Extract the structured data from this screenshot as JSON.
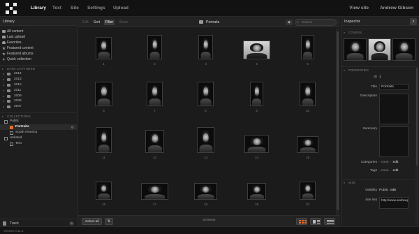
{
  "topbar": {
    "nav": [
      "Library",
      "Text",
      "Site",
      "Settings",
      "Upload"
    ],
    "active_nav": 0,
    "view_site": "View site",
    "user_name": "Andrew Gibson"
  },
  "sidebar": {
    "title": "Library",
    "items": [
      {
        "label": "All content",
        "icon": "stack-icon"
      },
      {
        "label": "Last upload",
        "icon": "upload-icon"
      },
      {
        "label": "Favorites",
        "icon": "heart-icon"
      },
      {
        "label": "Featured content",
        "icon": "star-icon"
      },
      {
        "label": "Featured albums",
        "icon": "star-album-icon"
      },
      {
        "label": "Quick collection",
        "icon": "lightning-icon"
      }
    ],
    "date_section": "DATE CAPTURED",
    "years": [
      "2014",
      "2013",
      "2012",
      "2011",
      "2009",
      "2008",
      "2007"
    ],
    "collections_section": "COLLECTIONS",
    "collections": [
      {
        "label": "Public",
        "level": 0,
        "selected": false
      },
      {
        "label": "Portraits",
        "level": 1,
        "selected": true
      },
      {
        "label": "South America",
        "level": 1,
        "selected": false
      },
      {
        "label": "Unlisted",
        "level": 0,
        "selected": false
      },
      {
        "label": "Test",
        "level": 1,
        "selected": false
      }
    ],
    "trash_label": "Trash",
    "trash_count": "3",
    "add_label": "+"
  },
  "toolbar": {
    "edit": "Edit",
    "sort": "Sort",
    "filter": "Filter",
    "share": "Share",
    "collection_title": "Portraits",
    "search_placeholder": "Search"
  },
  "grid": {
    "items": [
      {
        "n": "1",
        "style": "dark",
        "w": 22,
        "h": 30
      },
      {
        "n": "2",
        "style": "dark",
        "w": 19,
        "h": 32
      },
      {
        "n": "3",
        "style": "dark",
        "w": 19,
        "h": 32
      },
      {
        "n": "4",
        "style": "light",
        "w": 36,
        "h": 25
      },
      {
        "n": "5",
        "style": "dark",
        "w": 18,
        "h": 32
      },
      {
        "n": "6",
        "style": "dark",
        "w": 23,
        "h": 32
      },
      {
        "n": "7",
        "style": "dark",
        "w": 22,
        "h": 32
      },
      {
        "n": "8",
        "style": "dark",
        "w": 21,
        "h": 32
      },
      {
        "n": "9",
        "style": "dark",
        "w": 18,
        "h": 32
      },
      {
        "n": "10",
        "style": "dark",
        "w": 21,
        "h": 32
      },
      {
        "n": "11",
        "style": "dark",
        "w": 21,
        "h": 34
      },
      {
        "n": "12",
        "style": "dark",
        "w": 25,
        "h": 31
      },
      {
        "n": "13",
        "style": "dark",
        "w": 24,
        "h": 34
      },
      {
        "n": "14",
        "style": "dark",
        "w": 33,
        "h": 24
      },
      {
        "n": "15",
        "style": "dark",
        "w": 28,
        "h": 22
      },
      {
        "n": "16",
        "style": "dark",
        "w": 22,
        "h": 24
      },
      {
        "n": "17",
        "style": "dark",
        "w": 36,
        "h": 22
      },
      {
        "n": "18",
        "style": "dark",
        "w": 30,
        "h": 22
      },
      {
        "n": "19",
        "style": "dark",
        "w": 25,
        "h": 22
      },
      {
        "n": "20",
        "style": "dark",
        "w": 21,
        "h": 24
      }
    ]
  },
  "bottombar": {
    "select_all": "Select all",
    "sort_icon": "sort-arrows-icon",
    "item_count": "20 items",
    "view_modes": [
      "grid-view-icon",
      "detail-view-icon",
      "list-view-icon"
    ],
    "active_view": 0
  },
  "inspector": {
    "title": "Inspector",
    "covers_section": "COVERS",
    "covers": [
      "dark",
      "light",
      "dark"
    ],
    "properties_section": "PROPERTIES",
    "id_label": "ID",
    "id_value": "1",
    "title_label": "Title",
    "title_value": "Portraits",
    "description_label": "Description",
    "summary_label": "Summary",
    "categories_label": "Categories",
    "categories_value": "- none -",
    "tags_label": "Tags",
    "tags_value": "- none -",
    "edit_label": "edit",
    "site_section": "SITE",
    "visibility_label": "Visibility",
    "visibility_value": "Public",
    "site_link_label": "Site link",
    "site_link_value": "http://www.andrewgibson.com/portfolio"
  },
  "status": {
    "version": "Version 0.11.3"
  },
  "colors": {
    "accent": "#e26b2b",
    "background": "#1b1b1b",
    "topbar": "#121212"
  }
}
